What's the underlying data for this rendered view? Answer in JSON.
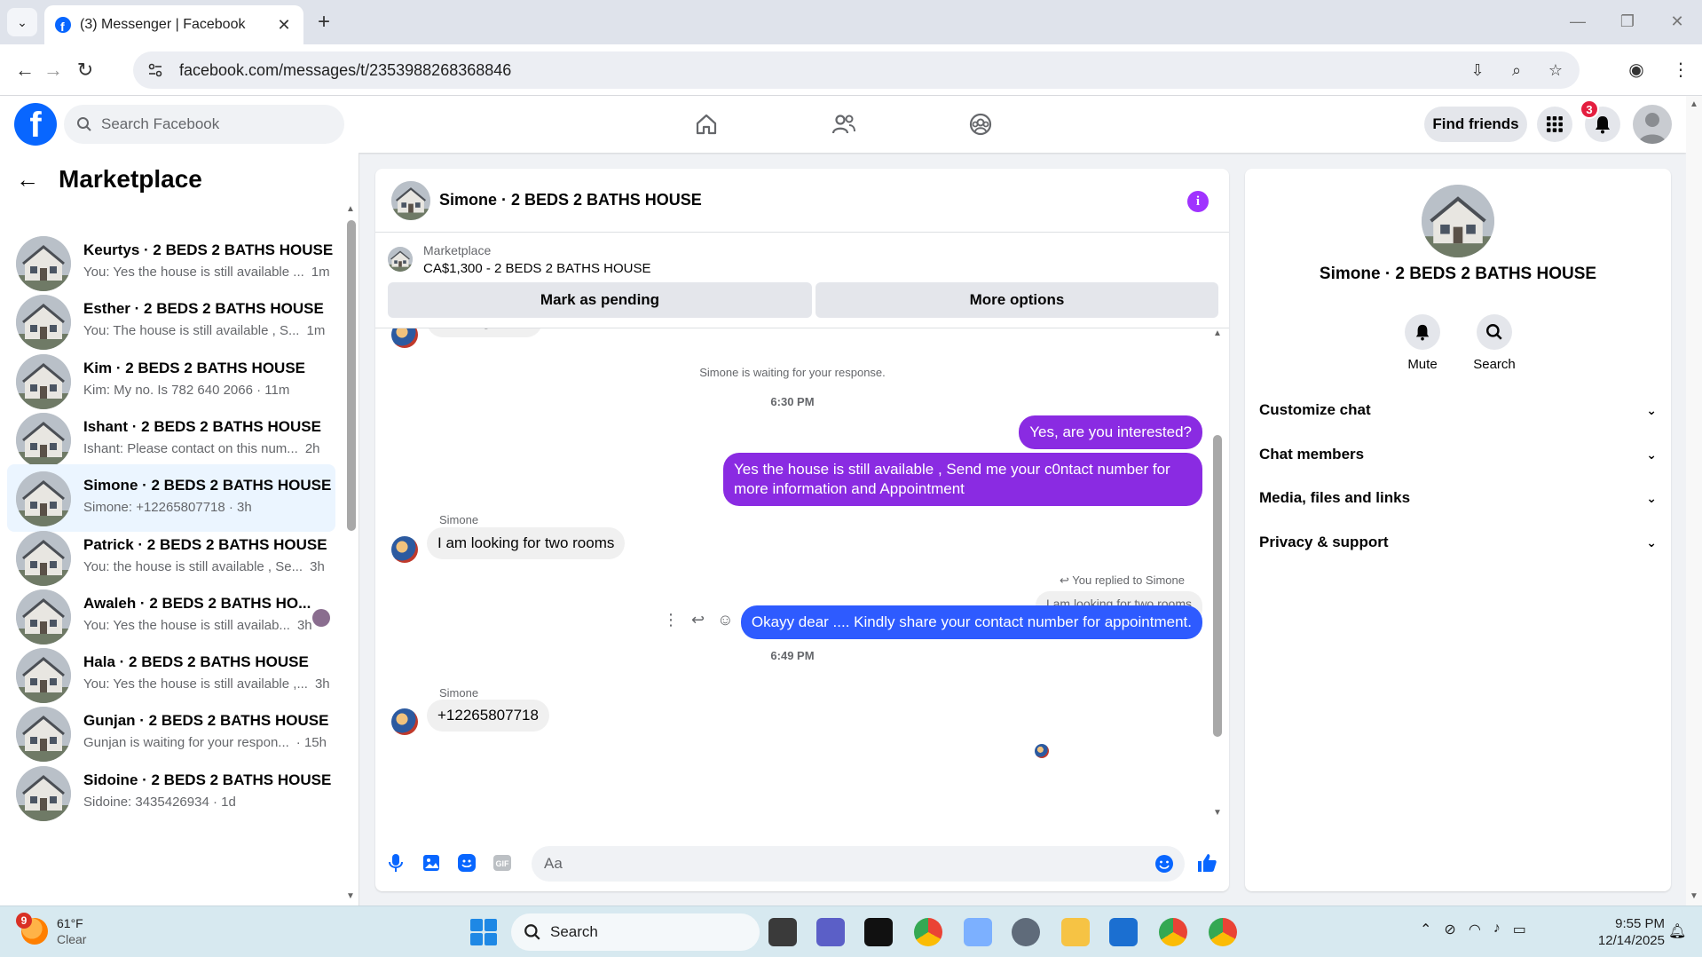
{
  "browser": {
    "tab_title": "(3) Messenger | Facebook",
    "url": "facebook.com/messages/t/2353988268368846"
  },
  "fb_header": {
    "search_placeholder": "Search Facebook",
    "find_friends": "Find friends",
    "notification_count": "3"
  },
  "left": {
    "title": "Marketplace",
    "conversations": [
      {
        "name": "Keurtys · 2 BEDS 2 BATHS HOUSE",
        "snippet": "You: Yes the house is still available ...",
        "time": "1m"
      },
      {
        "name": "Esther · 2 BEDS 2 BATHS HOUSE",
        "snippet": "You: The house is still available , S...",
        "time": "1m"
      },
      {
        "name": "Kim · 2 BEDS 2 BATHS HOUSE",
        "snippet": "Kim: My no. Is 782 640 2066 · 11m",
        "time": ""
      },
      {
        "name": "Ishant · 2 BEDS 2 BATHS HOUSE",
        "snippet": "Ishant: Please contact on this num...",
        "time": "2h"
      },
      {
        "name": "Simone · 2 BEDS 2 BATHS HOUSE",
        "snippet": "Simone: +12265807718 · 3h",
        "time": ""
      },
      {
        "name": "Patrick · 2 BEDS 2 BATHS HOUSE",
        "snippet": "You: the house is still available , Se...",
        "time": "3h"
      },
      {
        "name": "Awaleh · 2 BEDS 2 BATHS HO...",
        "snippet": "You: Yes the house is still availab...",
        "time": "3h"
      },
      {
        "name": "Hala · 2 BEDS 2 BATHS HOUSE",
        "snippet": "You: Yes the house is still available ,...",
        "time": "3h"
      },
      {
        "name": "Gunjan · 2 BEDS 2 BATHS HOUSE",
        "snippet": "Gunjan is waiting for your respon...",
        "time": "· 15h"
      },
      {
        "name": "Sidoine · 2 BEDS 2 BATHS HOUSE",
        "snippet": "Sidoine: 3435426934 · 1d",
        "time": ""
      }
    ]
  },
  "chat": {
    "header_name": "Simone · 2 BEDS 2 BATHS HOUSE",
    "marketplace_label": "Marketplace",
    "listing": "CA$1,300 - 2 BEDS 2 BATHS HOUSE",
    "mark_pending": "Mark as pending",
    "more_options": "More options",
    "partial_msg": "Message sent",
    "waiting_note": "Simone is waiting for your response.",
    "time1": "6:30 PM",
    "out1": "Yes, are you interested?",
    "out2": "Yes the house is still available , Send me your c0ntact number for more information and Appointment",
    "sender": "Simone",
    "in1": "I am looking for two rooms",
    "replied_note": "You replied to Simone",
    "quote": "I am looking for two rooms",
    "out3": "Okayy dear .... Kindly share your contact number for appointment.",
    "time2": "6:49 PM",
    "in2": "+12265807718",
    "composer_placeholder": "Aa"
  },
  "info": {
    "name": "Simone · 2 BEDS 2 BATHS HOUSE",
    "mute": "Mute",
    "search": "Search",
    "rows": [
      "Customize chat",
      "Chat members",
      "Media, files and links",
      "Privacy & support"
    ]
  },
  "taskbar": {
    "weather_temp": "61°F",
    "weather_desc": "Clear",
    "weather_badge": "9",
    "search": "Search",
    "time": "9:55 PM",
    "date": "12/14/2025"
  },
  "colors": {
    "fb_blue": "#0866ff",
    "out_bubble": "#8a2be2",
    "out_bubble_blue": "#2e5bff",
    "active_item": "#ebf5ff"
  }
}
